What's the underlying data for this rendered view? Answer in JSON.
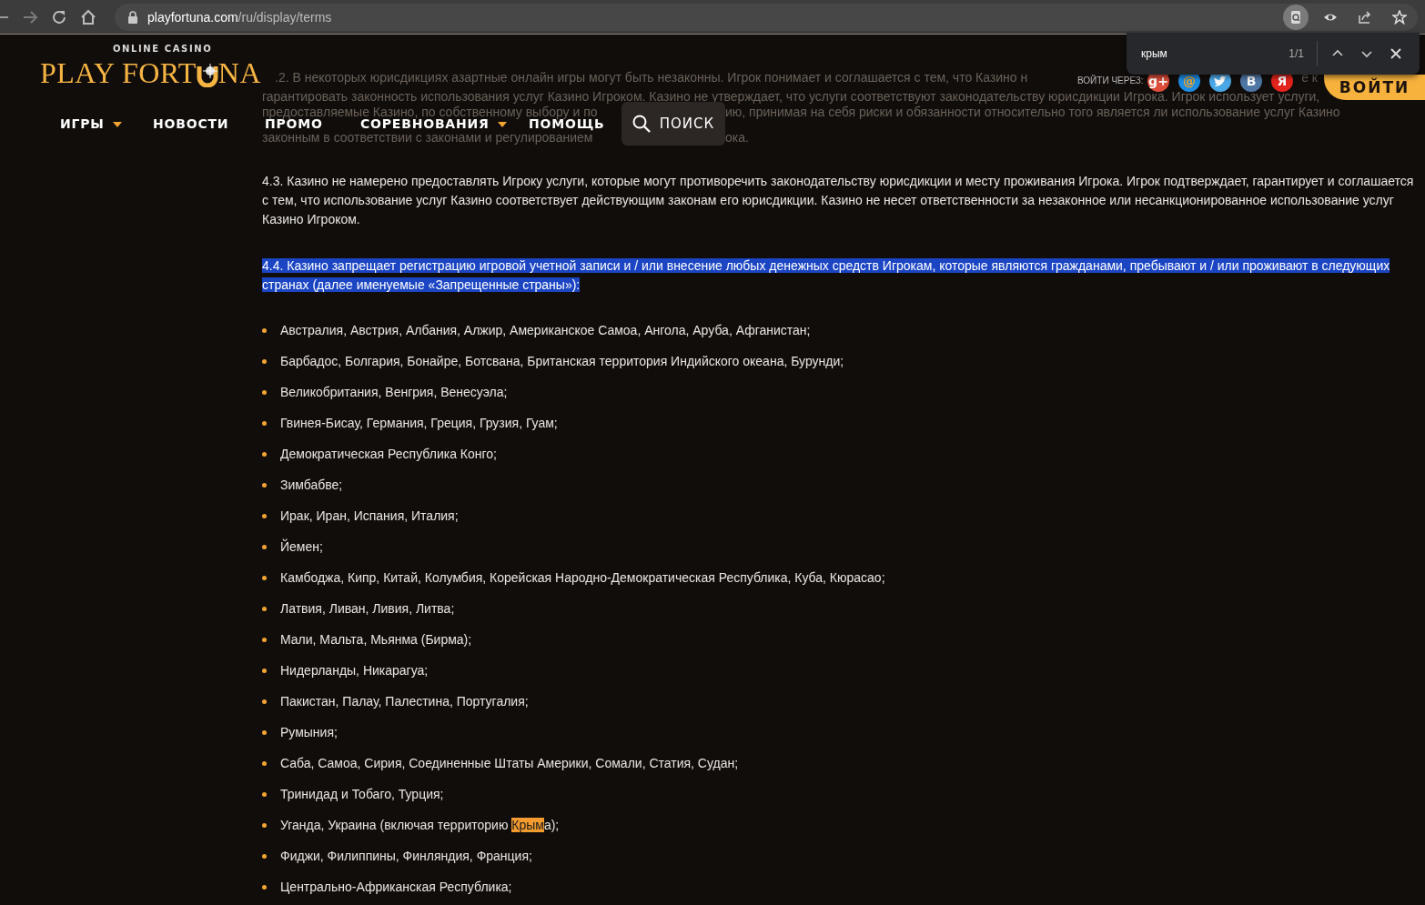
{
  "browser": {
    "url_host": "playfortuna.com",
    "url_path": "/ru/display/terms",
    "toolbar_icons": [
      {
        "kind": "lens",
        "active": true
      },
      {
        "kind": "eye",
        "active": false
      },
      {
        "kind": "share",
        "active": false
      },
      {
        "kind": "star",
        "active": false
      }
    ]
  },
  "find_bar": {
    "query": "крым",
    "count": "1/1"
  },
  "header": {
    "tagline": "ONLINE CASINO",
    "logo_start": "PLAY FORT",
    "logo_end": "NA",
    "nav": [
      {
        "label": "ИГРЫ",
        "has_dropdown": true
      },
      {
        "label": "НОВОСТИ",
        "has_dropdown": false
      },
      {
        "label": "ПРОМО",
        "has_dropdown": false
      },
      {
        "label": "СОРЕВНОВАНИЯ",
        "has_dropdown": true
      },
      {
        "label": "ПОМОЩЬ",
        "has_dropdown": false
      }
    ],
    "search_button": "ПОИСК",
    "login_via": "ВОЙТИ ЧЕРЕЗ:",
    "social": [
      {
        "kind": "google",
        "label": "g+"
      },
      {
        "kind": "mail",
        "label": "@"
      },
      {
        "kind": "twitter"
      },
      {
        "kind": "vk",
        "label": "В"
      },
      {
        "kind": "yandex",
        "label": "Я"
      }
    ],
    "login_button": "ВОЙТИ"
  },
  "faded_lines": [
    [
      ".2. В некоторых юрисдикциях азартные онлайн игры могут быть незаконны. Игрок понимает и соглашается с тем, что Казино н",
      "е к"
    ],
    [
      "гарантировать законность использования услуг Казино Игроком. Казино не утверждает, что услуги соответствуют законодательству юрисдикции Игрока. Игрок использует услуги,"
    ],
    [
      "предоставляемые Казино, по собственному выбору и по",
      "ию, принимая на себя риски и обязанности относительно того является ли использование услуг Казино"
    ],
    [
      "законным в соответствии с законами и регулированием",
      "ока."
    ]
  ],
  "paragraphs": [
    {
      "text": "4.3. Казино не намерено предоставлять Игроку услуги, которые могут противоречить законодательству юрисдикции и месту проживания Игрока. Игрок подтверждает, гарантирует и соглашается с тем, что использование услуг Казино соответствует действующим законам его юрисдикции. Казино не несет ответственности за незаконное или несанкционированное использование услуг Казино Игроком.",
      "selected": false
    },
    {
      "text": "4.4. Казино запрещает регистрацию игровой учетной записи и / или внесение любых денежных средств Игрокам, которые являются гражданами, пребывают и / или проживают в следующих странах (далее именуемые «Запрещенные страны»):",
      "selected": true
    }
  ],
  "countries": [
    {
      "text": "Австралия, Австрия, Албания, Алжир, Американское Самоа, Ангола, Аруба, Афганистан;"
    },
    {
      "text": "Барбадос, Болгария, Бонайре, Ботсвана, Британская территория Индийского океана, Бурунди;"
    },
    {
      "text": "Великобритания, Венгрия, Венесуэла;"
    },
    {
      "text": "Гвинея-Бисау, Германия, Греция, Грузия, Гуам;"
    },
    {
      "text": "Демократическая Республика Конго;"
    },
    {
      "text": "Зимбабве;"
    },
    {
      "text": "Ирак, Иран, Испания, Италия;"
    },
    {
      "text": "Йемен;"
    },
    {
      "text": "Камбоджа, Кипр, Китай, Колумбия, Корейская Народно-Демократическая Республика, Куба, Кюрасао;"
    },
    {
      "text": "Латвия, Ливан, Ливия, Литва;"
    },
    {
      "text": "Мали, Мальта, Мьянма (Бирма);"
    },
    {
      "text": "Нидерланды, Никарагуа;"
    },
    {
      "text": "Пакистан, Палау, Палестина, Португалия;"
    },
    {
      "text": "Румыния;"
    },
    {
      "text": "Саба, Самоа, Сирия, Соединенные Штаты Америки, Сомали, Статия, Судан;"
    },
    {
      "text": "Тринидад и Тобаго, Турция;"
    },
    {
      "segments": [
        {
          "text": "Уганда, Украина (включая территорию ",
          "match": false
        },
        {
          "text": "Крым",
          "match": true
        },
        {
          "text": "а);",
          "match": false
        }
      ]
    },
    {
      "text": "Фиджи, Филиппины, Финляндия, Франция;"
    },
    {
      "text": "Центрально-Африканская Республика;"
    }
  ]
}
